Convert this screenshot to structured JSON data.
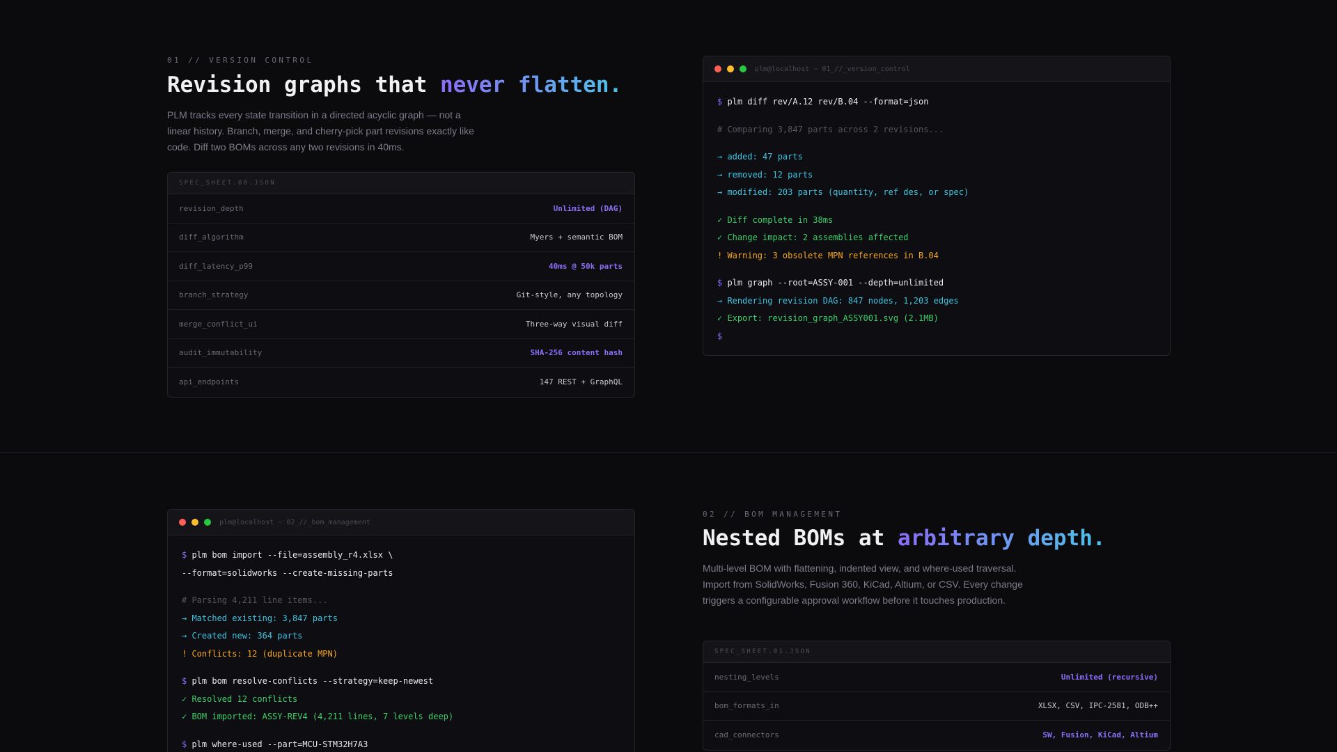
{
  "section1": {
    "eyebrow": "01 // VERSION CONTROL",
    "headline_plain": "Revision graphs that ",
    "headline_accent": "never flatten.",
    "description": "PLM tracks every state transition in a directed acyclic graph — not a linear history. Branch, merge, and cherry-pick part revisions exactly like code. Diff two BOMs across any two revisions in 40ms.",
    "spec_title": "SPEC_SHEET.00.JSON",
    "spec_rows": [
      {
        "key": "revision_depth",
        "value": "Unlimited (DAG)"
      },
      {
        "key": "diff_algorithm",
        "value": "Myers + semantic BOM"
      },
      {
        "key": "diff_latency_p99",
        "value": "40ms @ 50k parts"
      },
      {
        "key": "branch_strategy",
        "value": "Git-style, any topology"
      },
      {
        "key": "merge_conflict_ui",
        "value": "Three-way visual diff"
      },
      {
        "key": "audit_immutability",
        "value": "SHA-256 content hash"
      },
      {
        "key": "api_endpoints",
        "value": "147 REST + GraphQL"
      }
    ],
    "terminal_title": "plm@localhost ~ 01_//_version_control",
    "terminal_lines": [
      {
        "prompt": "$ ",
        "text": "plm diff rev/A.12 rev/B.04 --format=json"
      },
      {
        "text": "# Comparing 3,847 parts across 2 revisions..."
      },
      {
        "text": "→ added: 47 parts"
      },
      {
        "text": "→ removed: 12 parts"
      },
      {
        "text": "→ modified: 203 parts (quantity, ref des, or spec)"
      },
      {
        "text": "✓ Diff complete in 38ms"
      },
      {
        "text": "✓ Change impact: 2 assemblies affected"
      },
      {
        "text": "! Warning: 3 obsolete MPN references in B.04"
      },
      {
        "prompt": "$ ",
        "text": "plm graph --root=ASSY-001 --depth=unlimited"
      },
      {
        "text": "→ Rendering revision DAG: 847 nodes, 1,203 edges"
      },
      {
        "text": "✓ Export: revision_graph_ASSY001.svg (2.1MB)"
      },
      {
        "prompt": "$",
        "text": ""
      }
    ]
  },
  "section2": {
    "eyebrow": "02 // BOM MANAGEMENT",
    "headline_plain": "Nested BOMs at ",
    "headline_accent": "arbitrary depth.",
    "description": "Multi-level BOM with flattening, indented view, and where-used traversal. Import from SolidWorks, Fusion 360, KiCad, Altium, or CSV. Every change triggers a configurable approval workflow before it touches production.",
    "spec_title": "SPEC_SHEET.01.JSON",
    "spec_rows": [
      {
        "key": "nesting_levels",
        "value": "Unlimited (recursive)"
      },
      {
        "key": "bom_formats_in",
        "value": "XLSX, CSV, IPC-2581, ODB++"
      },
      {
        "key": "cad_connectors",
        "value": "SW, Fusion, KiCad, Altium"
      }
    ],
    "terminal_title": "plm@localhost ~ 02_//_bom_management",
    "terminal_lines": [
      {
        "prompt": "$ ",
        "text": "plm bom import --file=assembly_r4.xlsx \\"
      },
      {
        "text": "--format=solidworks --create-missing-parts"
      },
      {
        "text": "# Parsing 4,211 line items..."
      },
      {
        "text": "→ Matched existing: 3,847 parts"
      },
      {
        "text": "→ Created new: 364 parts"
      },
      {
        "text": "! Conflicts: 12 (duplicate MPN)"
      },
      {
        "prompt": "$ ",
        "text": "plm bom resolve-conflicts --strategy=keep-newest"
      },
      {
        "text": "✓ Resolved 12 conflicts"
      },
      {
        "text": "✓ BOM imported: ASSY-REV4 (4,211 lines, 7 levels deep)"
      },
      {
        "prompt": "$ ",
        "text": "plm where-used --part=MCU-STM32H7A3"
      }
    ]
  }
}
